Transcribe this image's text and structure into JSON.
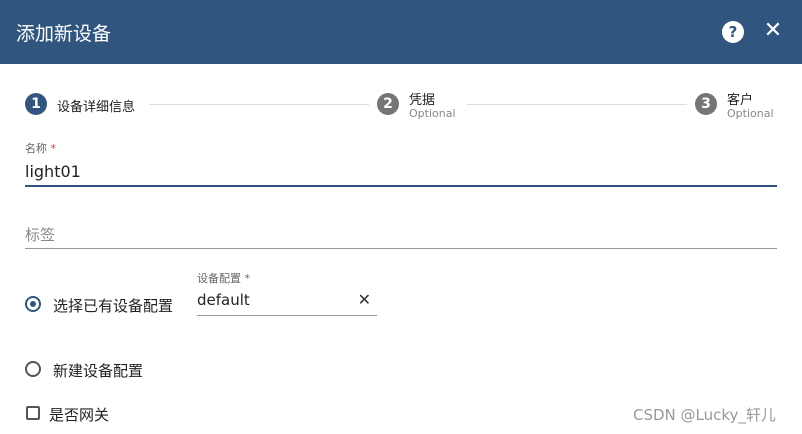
{
  "dialog": {
    "title": "添加新设备",
    "help_icon": "question-circle-icon",
    "close_icon": "close-icon",
    "help_glyph": "?",
    "close_glyph": "✕"
  },
  "stepper": {
    "steps": [
      {
        "number": "1",
        "label": "设备详细信息",
        "sub": "",
        "active": true
      },
      {
        "number": "2",
        "label": "凭据",
        "sub": "Optional",
        "active": false
      },
      {
        "number": "3",
        "label": "客户",
        "sub": "Optional",
        "active": false
      }
    ],
    "active_color": "#305680",
    "inactive_color": "#757575"
  },
  "form": {
    "name": {
      "label": "名称",
      "required_mark": "*",
      "value": "light01"
    },
    "tag": {
      "placeholder": "标签"
    },
    "profile_choice": {
      "existing_label": "选择已有设备配置",
      "new_label": "新建设备配置",
      "selected": "existing"
    },
    "device_profile": {
      "label": "设备配置",
      "required_mark": "*",
      "value": "default",
      "clear_glyph": "✕"
    },
    "gateway": {
      "label": "是否网关",
      "checked": false
    }
  },
  "watermark": "CSDN @Lucky_轩儿",
  "colors": {
    "header": "#305680",
    "accent": "#305680"
  }
}
